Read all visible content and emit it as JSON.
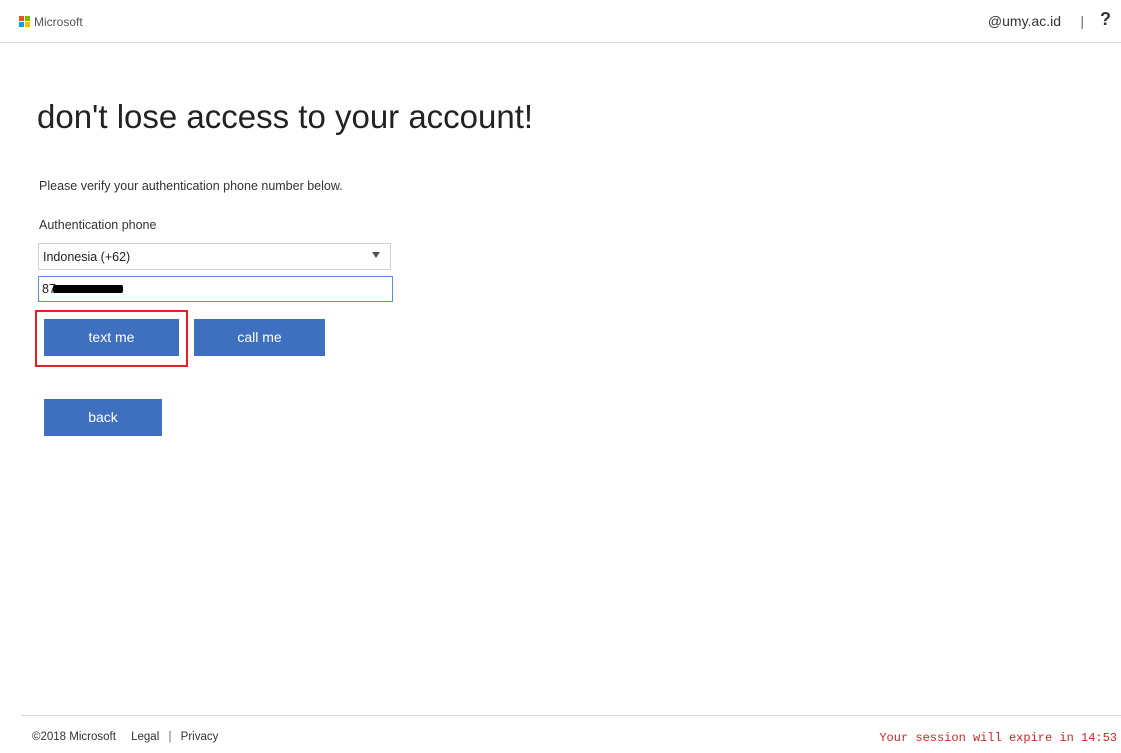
{
  "header": {
    "brand": "Microsoft",
    "account": "@umy.ac.id",
    "separator": "|",
    "help_label": "?"
  },
  "main": {
    "title": "don't lose access to your account!",
    "instruction": "Please verify your authentication phone number below.",
    "phone_label": "Authentication phone",
    "country": "Indonesia (+62)",
    "phone_value": "87",
    "text_me_label": "text me",
    "call_me_label": "call me",
    "back_label": "back"
  },
  "footer": {
    "copyright": "©2018 Microsoft",
    "legal_label": "Legal",
    "separator": "|",
    "privacy_label": "Privacy",
    "session": "Your session will expire in 14:53"
  },
  "colors": {
    "accent": "#3f6fbf",
    "highlight": "#e0211f",
    "session_text": "#d32222",
    "logo": [
      "#f25022",
      "#7fba00",
      "#00a4ef",
      "#ffb900"
    ]
  },
  "icons": {
    "logo": "microsoft-logo-icon",
    "dropdown": "chevron-down-icon"
  }
}
